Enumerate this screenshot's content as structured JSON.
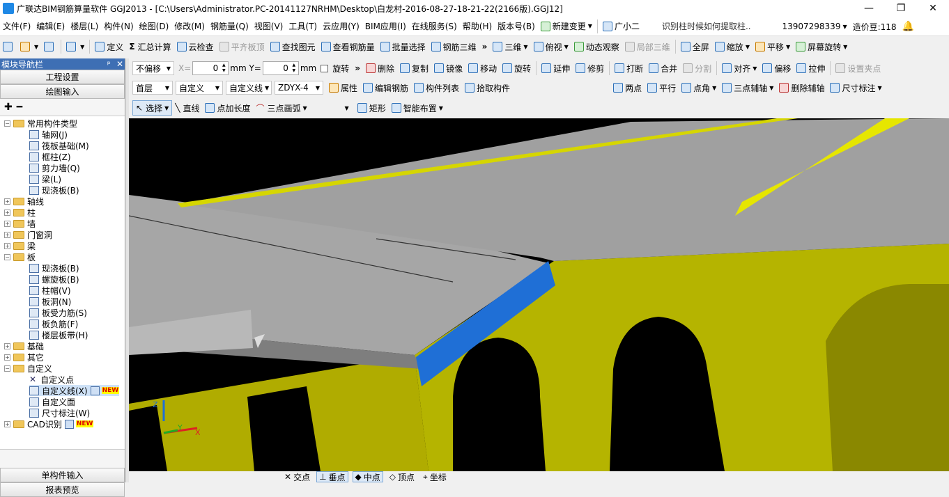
{
  "window": {
    "title": "广联达BIM钢筋算量软件 GGJ2013 - [C:\\Users\\Administrator.PC-20141127NRHM\\Desktop\\白龙村-2016-08-27-18-21-22(2166版).GGJ12]",
    "minimize": "—",
    "maximize": "❐",
    "close": "✕"
  },
  "menubar": {
    "items": [
      "文件(F)",
      "编辑(E)",
      "楼层(L)",
      "构件(N)",
      "绘图(D)",
      "修改(M)",
      "钢筋量(Q)",
      "视图(V)",
      "工具(T)",
      "云应用(Y)",
      "BIM应用(I)",
      "在线服务(S)",
      "帮助(H)",
      "版本号(B)"
    ],
    "new_change": "新建变更",
    "assistant": "广小二",
    "hint": "识别柱时候如何提取柱..",
    "phone": "13907298339",
    "beans": "造价豆:118"
  },
  "toolbar1": {
    "define": "定义",
    "sum_calc": "汇总计算",
    "cloud_check": "云检查",
    "level_top": "平齐板顶",
    "find_element": "查找图元",
    "view_rebar": "查看钢筋量",
    "batch_select": "批量选择",
    "rebar_3d": "钢筋三维",
    "three_d": "三维",
    "top_view": "俯视",
    "dynamic_observe": "动态观察",
    "local_3d": "局部三维",
    "full_screen": "全屏",
    "zoom": "缩放",
    "pan": "平移",
    "screen_rotate": "屏幕旋转"
  },
  "toolbar2": {
    "offset_mode": "不偏移",
    "x_label": "X=",
    "x_value": "0",
    "y_label": "mm Y=",
    "y_value": "0",
    "mm": "mm",
    "rotate_check": "旋转",
    "delete": "删除",
    "copy": "复制",
    "mirror": "镜像",
    "move": "移动",
    "rotate": "旋转",
    "extend": "延伸",
    "trim": "修剪",
    "break": "打断",
    "merge": "合并",
    "split": "分割",
    "align": "对齐",
    "offset": "偏移",
    "stretch": "拉伸",
    "set_grip": "设置夹点"
  },
  "toolbar3": {
    "floor": "首层",
    "category": "自定义",
    "type": "自定义线",
    "element": "ZDYX-4",
    "properties": "属性",
    "edit_rebar": "编辑钢筋",
    "element_list": "构件列表",
    "pick_element": "拾取构件",
    "two_points": "两点",
    "parallel": "平行",
    "point_angle": "点角",
    "three_point_aux": "三点辅轴",
    "delete_aux": "删除辅轴",
    "dim": "尺寸标注"
  },
  "toolbar4": {
    "select": "选择",
    "line": "直线",
    "point_length": "点加长度",
    "three_point_arc": "三点画弧",
    "rect": "矩形",
    "smart_layout": "智能布置"
  },
  "sidebar": {
    "title": "模块导航栏",
    "pin": "ᵖ",
    "close": "✕",
    "project_settings": "工程设置",
    "drawing_input": "绘图输入",
    "single_input": "单构件输入",
    "report_preview": "报表预览",
    "tree": {
      "common": "常用构件类型",
      "common_items": [
        "轴网(J)",
        "筏板基础(M)",
        "框柱(Z)",
        "剪力墙(Q)",
        "梁(L)",
        "现浇板(B)"
      ],
      "axis": "轴线",
      "column": "柱",
      "wall": "墙",
      "openings": "门窗洞",
      "beam": "梁",
      "slab": "板",
      "slab_items": [
        "现浇板(B)",
        "螺旋板(B)",
        "柱帽(V)",
        "板洞(N)",
        "板受力筋(S)",
        "板负筋(F)",
        "楼层板带(H)"
      ],
      "foundation": "基础",
      "other": "其它",
      "custom": "自定义",
      "custom_items": [
        "自定义点",
        "自定义线(X)",
        "自定义面",
        "尺寸标注(W)"
      ],
      "cad": "CAD识别",
      "new_badge": "NEW"
    }
  },
  "snapbar": {
    "items": [
      "交点",
      "垂点",
      "中点",
      "顶点",
      "坐标"
    ]
  },
  "axes": {
    "x": "X",
    "y": "Y",
    "z": "Z"
  },
  "colors": {
    "accent": "#3e6fb4",
    "slab": "#a8a8a8",
    "beam_yellow": "#b5b400",
    "highlight_blue": "#1f6fd6"
  }
}
